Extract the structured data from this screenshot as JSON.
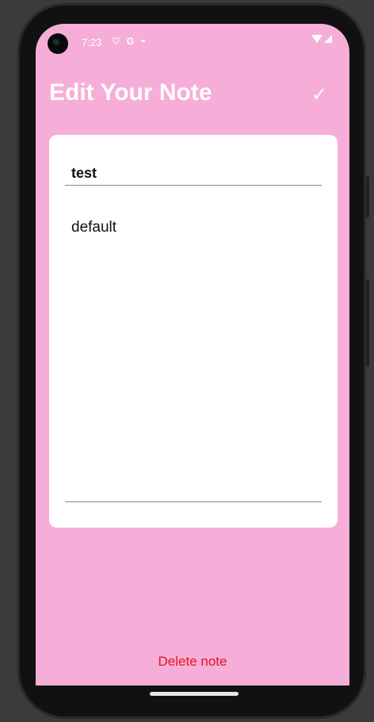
{
  "status_bar": {
    "time": "7:23",
    "icons": [
      "shield-icon",
      "google-icon",
      "circle-icon"
    ],
    "icon_glyphs": [
      "♡",
      "G",
      "◓"
    ]
  },
  "app_bar": {
    "title": "Edit Your Note",
    "confirm_glyph": "✓"
  },
  "note": {
    "title_value": "test",
    "body_value": "default"
  },
  "footer": {
    "delete_label": "Delete note"
  },
  "colors": {
    "background": "#f6aed8",
    "card": "#ffffff",
    "delete": "#e8121c"
  }
}
